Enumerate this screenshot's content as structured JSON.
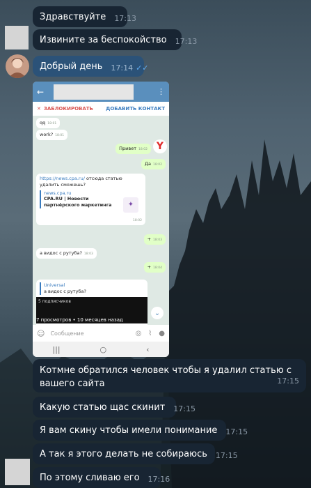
{
  "messages": [
    {
      "text": "Здравствуйте",
      "time": "17:13"
    },
    {
      "text": "Извините за беспокойство",
      "time": "17:13"
    },
    {
      "text": "Добрый день",
      "time": "17:14"
    }
  ],
  "screenshot": {
    "actions": {
      "block": "ЗАБЛОКИРОВАТЬ",
      "add": "ДОБАВИТЬ КОНТАКТ"
    },
    "chat": {
      "m1": {
        "text": "qq",
        "time": "18:01"
      },
      "m2": {
        "text": "work?",
        "time": "18:01"
      },
      "m3": {
        "text": "Привет",
        "time": "18:02"
      },
      "m4": {
        "text": "Да",
        "time": "18:02"
      },
      "m5": {
        "link": "https://news.cpa.ru/",
        "text": " отсюда статью удалить сможешь?",
        "site": "news.cpa.ru",
        "title": "CPA.RU | Новости партнёрского маркетинга",
        "time": "18:02"
      },
      "m6": {
        "text": "+",
        "time": "18:03"
      },
      "m7": {
        "text": "а видос с рутуба?",
        "time": "18:03"
      },
      "m8": {
        "text": "+",
        "time": "18:04"
      },
      "m9": {
        "sender": "Universal",
        "quote": "а видос с рутуба?",
        "subs": "5 подписчиков",
        "meta": "7 просмотров  •  10 месяцев назад"
      }
    },
    "input_placeholder": "Сообщение"
  },
  "messages_after": [
    {
      "text": "Котмне обратился человек чтобы я удалил статью с вашего сайта",
      "time": "17:15"
    },
    {
      "text": "Какую статью щас скинит",
      "time": "17:15"
    },
    {
      "text": "Я вам скину чтобы имели понимание",
      "time": "17:15"
    },
    {
      "text": "А так я этого делать не собираюсь",
      "time": "17:15"
    },
    {
      "text": "По этому сливаю его",
      "time": "17:16"
    }
  ],
  "icons": {
    "back": "back-arrow-icon",
    "menu": "more-vert-icon",
    "emoji": "emoji-icon",
    "camera": "camera-icon",
    "attach": "attach-icon",
    "mic": "mic-icon",
    "scroll_down": "chevron-down-icon"
  }
}
